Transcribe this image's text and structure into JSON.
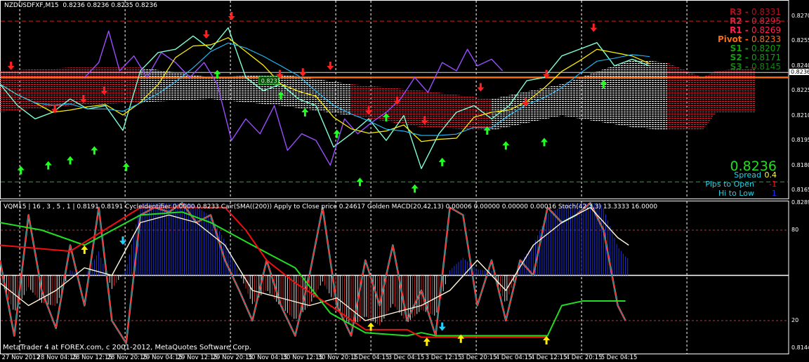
{
  "header": {
    "symbol": "NZDUSDFXF,M15",
    "ohlc": "0.8236 0.8236 0.8235 0.8236"
  },
  "pivots": [
    {
      "label": "R3",
      "value": "0.8331",
      "color": "#b01020"
    },
    {
      "label": "R2",
      "value": "0.8295",
      "color": "#e02040"
    },
    {
      "label": "R1",
      "value": "0.8269",
      "color": "#ff2050"
    },
    {
      "label": "Pivot",
      "value": "0.8233",
      "color": "#ff6a10"
    },
    {
      "label": "S1",
      "value": "0.8207",
      "color": "#10a010"
    },
    {
      "label": "S2",
      "value": "0.8171",
      "color": "#10a010"
    },
    {
      "label": "S3",
      "value": "0.8145",
      "color": "#108010"
    }
  ],
  "info": {
    "price": "0.8236",
    "spread_label": "Spread",
    "spread_value": "0.4",
    "pips_label": "Pips to Open",
    "pips_value": "-1",
    "hilo_label": "Hi to Low",
    "hilo_value": "1"
  },
  "price_tag": "0.8231",
  "subwindow": {
    "header": "VQM15 | 16 , 3 , 5 , 1 | 0.8191 0.8191 CycleIdentifier 0.0000 0.8233 Cair(SMA((200)) Apply to Close price 0.24617 Golden MACD(20,42,13) 0.00006 0.00000 0.00000 0.00016 Stoch(42,3,3) 13.3333 16.0000"
  },
  "copyright": "MetaTrader 4 at FOREX.com, c 2001-2012, MetaQuotes Software Corp.",
  "chart_data": [
    {
      "type": "line",
      "title": "NZDUSDFXF,M15",
      "xunit": "bar index (M15)",
      "ylim": [
        0.8158,
        0.828
      ],
      "yticks": [
        "0.8270",
        "0.8255",
        "0.8240",
        "0.8225",
        "0.8210",
        "0.8195",
        "0.8180",
        "0.8165"
      ],
      "current_price": 0.8236,
      "pivot_line": 0.8233,
      "hlines": {
        "upper_dashed": 0.8267,
        "lower_dashed": 0.817
      },
      "xticks": [
        {
          "bar": 1,
          "label": "27 Nov 2012"
        },
        {
          "bar": 33,
          "label": "28 Nov 04:15"
        },
        {
          "bar": 65,
          "label": "28 Nov 12:15"
        },
        {
          "bar": 97,
          "label": "28 Nov 20:15"
        },
        {
          "bar": 129,
          "label": "29 Nov 04:15"
        },
        {
          "bar": 161,
          "label": "29 Nov 12:15"
        },
        {
          "bar": 193,
          "label": "29 Nov 20:15"
        },
        {
          "bar": 225,
          "label": "30 Nov 04:15"
        },
        {
          "bar": 257,
          "label": "30 Nov 12:15"
        },
        {
          "bar": 289,
          "label": "30 Nov 20:15"
        },
        {
          "bar": 321,
          "label": "1 Dec 04:15"
        },
        {
          "bar": 353,
          "label": "3 Dec 04:15"
        },
        {
          "bar": 387,
          "label": "3 Dec 12:15"
        },
        {
          "bar": 419,
          "label": "3 Dec 20:15"
        },
        {
          "bar": 451,
          "label": "4 Dec 04:15"
        },
        {
          "bar": 483,
          "label": "4 Dec 12:15"
        },
        {
          "bar": 515,
          "label": "4 Dec 20:15"
        },
        {
          "bar": 547,
          "label": "5 Dec 04:15"
        }
      ],
      "separators": [
        18,
        114,
        210,
        306,
        338,
        434,
        530,
        626
      ],
      "series": [
        {
          "name": "price",
          "color": "#7fffd4",
          "x": [
            0,
            16,
            32,
            48,
            64,
            80,
            96,
            112,
            128,
            144,
            160,
            176,
            192,
            208,
            224,
            240,
            256,
            272,
            288,
            304,
            320,
            336,
            352,
            368,
            384,
            400,
            416,
            432,
            448,
            464,
            480,
            496,
            512,
            528,
            544,
            560,
            576,
            592
          ],
          "y": [
            0.8229,
            0.8216,
            0.8208,
            0.8212,
            0.822,
            0.8214,
            0.8216,
            0.8201,
            0.8237,
            0.8248,
            0.825,
            0.8258,
            0.825,
            0.8263,
            0.8233,
            0.8225,
            0.8229,
            0.822,
            0.8216,
            0.8191,
            0.8199,
            0.8208,
            0.8195,
            0.821,
            0.8178,
            0.8199,
            0.8212,
            0.8216,
            0.8208,
            0.8216,
            0.8231,
            0.8233,
            0.8246,
            0.825,
            0.8254,
            0.824,
            0.8244,
            0.824
          ]
        },
        {
          "name": "compare",
          "color": "#9b4dff",
          "x": [
            77,
            90,
            99,
            109,
            122,
            134,
            147,
            160,
            173,
            186,
            198,
            211,
            224,
            237,
            250,
            262,
            275,
            288,
            301,
            314,
            326,
            339,
            352,
            365,
            378,
            390,
            403,
            416,
            426,
            435,
            448,
            458
          ],
          "y": [
            0.8233,
            0.8242,
            0.8261,
            0.8237,
            0.8246,
            0.8233,
            0.8248,
            0.8242,
            0.8233,
            0.8242,
            0.8229,
            0.8195,
            0.8208,
            0.8199,
            0.8216,
            0.8189,
            0.8199,
            0.8195,
            0.818,
            0.8208,
            0.8199,
            0.8206,
            0.8212,
            0.822,
            0.8233,
            0.8224,
            0.8242,
            0.8237,
            0.825,
            0.824,
            0.8244,
            0.8237
          ]
        }
      ],
      "cloud": {
        "x": [
          0,
          64,
          128,
          192,
          256,
          320,
          384,
          448,
          512,
          576,
          608,
          640,
          653,
          688
        ],
        "upper": [
          0.8237,
          0.8239,
          0.8239,
          0.8233,
          0.8235,
          0.8229,
          0.8225,
          0.822,
          0.8229,
          0.8244,
          0.8242,
          0.8233,
          0.8237,
          0.8239
        ],
        "lower": [
          0.8212,
          0.8216,
          0.8218,
          0.822,
          0.8216,
          0.821,
          0.8203,
          0.8201,
          0.821,
          0.8203,
          0.8201,
          0.8201,
          0.8212,
          0.8212
        ],
        "kinds": [
          "bear",
          "bear",
          "bull",
          "bull",
          "bull",
          "bear",
          "bear",
          "bull",
          "bull",
          "bull",
          "bear",
          "bear",
          "bear"
        ]
      },
      "sell_arrows": [
        [
          10,
          0.824
        ],
        [
          50,
          0.8214
        ],
        [
          76,
          0.822
        ],
        [
          95,
          0.8225
        ],
        [
          188,
          0.8259
        ],
        [
          211,
          0.827
        ],
        [
          255,
          0.8235
        ],
        [
          276,
          0.8236
        ],
        [
          301,
          0.824
        ],
        [
          336,
          0.8213
        ],
        [
          362,
          0.8219
        ],
        [
          387,
          0.8207
        ],
        [
          438,
          0.8227
        ],
        [
          479,
          0.8218
        ],
        [
          498,
          0.8235
        ],
        [
          541,
          0.8263
        ]
      ],
      "buy_arrows": [
        [
          19,
          0.8177
        ],
        [
          44,
          0.818
        ],
        [
          64,
          0.8183
        ],
        [
          86,
          0.8189
        ],
        [
          115,
          0.8179
        ],
        [
          198,
          0.8235
        ],
        [
          256,
          0.8222
        ],
        [
          278,
          0.8212
        ],
        [
          307,
          0.8199
        ],
        [
          328,
          0.817
        ],
        [
          352,
          0.8209
        ],
        [
          378,
          0.8166
        ],
        [
          403,
          0.8182
        ],
        [
          444,
          0.8201
        ],
        [
          461,
          0.8192
        ],
        [
          496,
          0.8194
        ],
        [
          550,
          0.8229
        ]
      ]
    },
    {
      "type": "line",
      "title": "VQM15 oscillator",
      "ylim": [
        0,
        100
      ],
      "yticks": [
        "0.8289",
        "80",
        "20",
        "0.8144"
      ],
      "levels": [
        80,
        50,
        20
      ],
      "series": [
        {
          "name": "fast",
          "color": "#ff2020",
          "x": [
            0,
            13,
            26,
            38,
            51,
            64,
            77,
            90,
            102,
            115,
            128,
            141,
            154,
            166,
            179,
            192,
            205,
            218,
            230,
            243,
            256,
            269,
            282,
            294,
            307,
            320,
            333,
            346,
            358,
            371,
            384,
            397,
            410,
            422,
            435,
            448,
            461,
            474,
            486,
            499,
            512,
            525,
            538,
            550,
            563,
            570
          ],
          "y": [
            60,
            10,
            90,
            40,
            15,
            70,
            30,
            95,
            20,
            5,
            90,
            95,
            92,
            98,
            85,
            90,
            60,
            40,
            20,
            60,
            30,
            10,
            50,
            95,
            30,
            10,
            60,
            30,
            70,
            20,
            40,
            10,
            95,
            90,
            30,
            60,
            20,
            60,
            50,
            95,
            85,
            90,
            98,
            80,
            30,
            20
          ]
        },
        {
          "name": "slow",
          "color": "#fff8dc",
          "x": [
            0,
            26,
            51,
            77,
            102,
            128,
            154,
            179,
            205,
            230,
            256,
            282,
            307,
            333,
            358,
            384,
            410,
            435,
            461,
            486,
            512,
            538,
            563,
            573
          ],
          "y": [
            45,
            30,
            40,
            55,
            50,
            85,
            90,
            85,
            70,
            40,
            35,
            30,
            35,
            20,
            25,
            30,
            40,
            60,
            40,
            70,
            85,
            95,
            75,
            70
          ]
        },
        {
          "name": "trend-green",
          "color": "#22dd22",
          "x": [
            0,
            38,
            77,
            128,
            166,
            192,
            230,
            269,
            301,
            333,
            371,
            384,
            397,
            499,
            512,
            531,
            570
          ],
          "y": [
            85,
            80,
            70,
            90,
            92,
            85,
            70,
            55,
            25,
            12,
            10,
            12,
            10,
            10,
            30,
            33,
            33
          ]
        },
        {
          "name": "trend-red",
          "color": "#ee1010",
          "x": [
            0,
            64,
            128,
            166,
            205,
            224,
            243,
            269,
            301,
            333,
            371,
            384,
            499
          ],
          "y": [
            70,
            66,
            95,
            95,
            95,
            80,
            60,
            45,
            30,
            14,
            14,
            9,
            9
          ]
        }
      ],
      "up_arrows_yellow": [
        [
          77,
          67
        ],
        [
          338,
          16
        ],
        [
          389,
          6
        ],
        [
          420,
          8
        ],
        [
          498,
          7
        ]
      ],
      "down_arrows_cyan": [
        [
          112,
          73
        ],
        [
          403,
          16
        ]
      ]
    }
  ]
}
